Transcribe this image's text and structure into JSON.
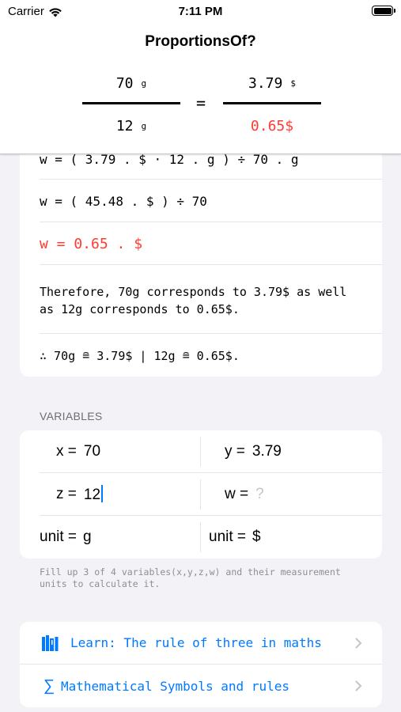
{
  "status_bar": {
    "carrier": "Carrier",
    "time": "7:11 PM"
  },
  "nav": {
    "title": "ProportionsOf?"
  },
  "proportion": {
    "left_numerator": "70",
    "left_numerator_unit": "g",
    "left_denominator": "12",
    "left_denominator_unit": "g",
    "equals": "=",
    "right_numerator": "3.79",
    "right_numerator_unit": "$",
    "right_denominator": "0.65$"
  },
  "steps": [
    "w = ( 3.79 . $ · 12 . g ) ÷ 70 . g",
    "w = ( 45.48 . $ ) ÷ 70",
    "w = 0.65 . $",
    "Therefore, 70g corresponds to 3.79$ as well as 12g corresponds to 0.65$.",
    "∴ 70g ≘ 3.79$ | 12g ≘ 0.65$."
  ],
  "variables": {
    "section_label": "VARIABLES",
    "x_label": "x =",
    "x_value": "70",
    "y_label": "y =",
    "y_value": "3.79",
    "z_label": "z =",
    "z_value": "12",
    "w_label": "w =",
    "w_placeholder": "?",
    "unit1_label": "unit =",
    "unit1_value": "g",
    "unit2_label": "unit =",
    "unit2_value": "$"
  },
  "hint": "Fill up 3 of 4 variables(x,y,z,w) and their measurement units to calculate it.",
  "links": {
    "learn": {
      "icon": "books-icon",
      "label": "Learn: The rule of three in maths"
    },
    "symbols": {
      "icon": "sigma-icon",
      "icon_glyph": "∑",
      "label": "Mathematical Symbols and rules"
    }
  },
  "colors": {
    "accent": "#007aff",
    "result": "#ff3b30",
    "background": "#f2f2f7"
  }
}
